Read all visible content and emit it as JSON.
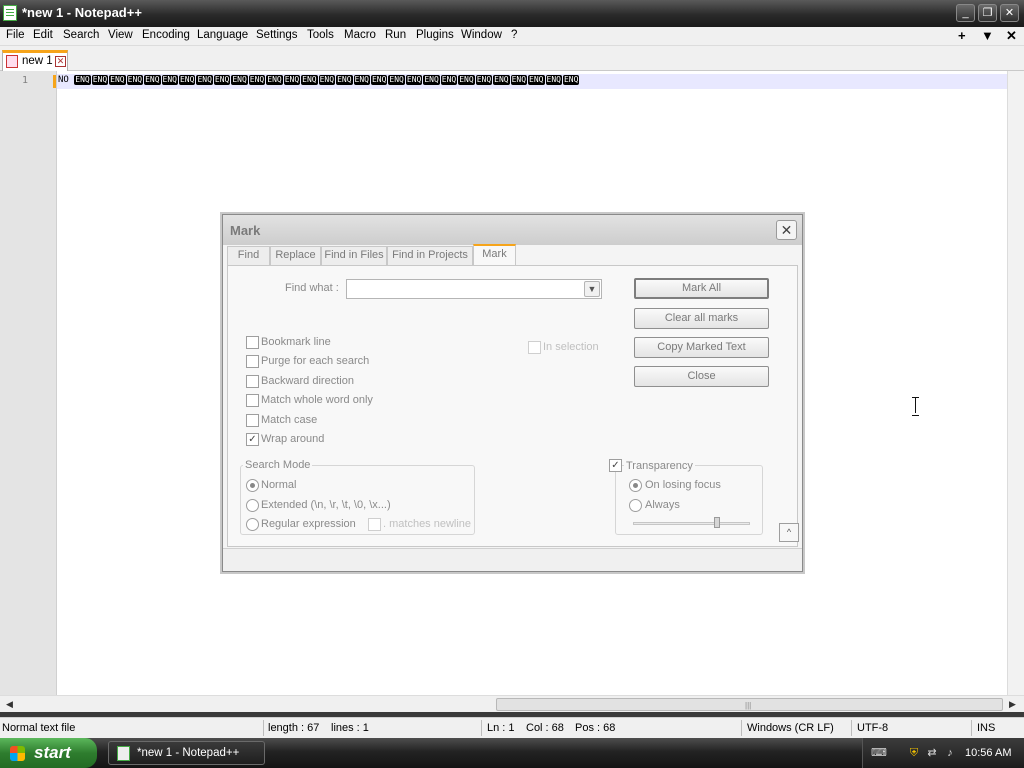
{
  "window": {
    "title": "*new 1 - Notepad++",
    "controls": [
      "minimize",
      "restore",
      "close"
    ]
  },
  "menu": {
    "items": [
      "File",
      "Edit",
      "Search",
      "View",
      "Encoding",
      "Language",
      "Settings",
      "Tools",
      "Macro",
      "Run",
      "Plugins",
      "Window",
      "?"
    ],
    "right": [
      "+",
      "▼",
      "✕"
    ]
  },
  "tabs": [
    {
      "label": "new 1",
      "close": "✕",
      "active": true
    }
  ],
  "editor": {
    "line_number": "1",
    "prefix_text": "NO",
    "char_symbol": "ENQ",
    "char_count": 29
  },
  "dialog": {
    "title": "Mark",
    "close": "✕",
    "tabs": [
      "Find",
      "Replace",
      "Find in Files",
      "Find in Projects",
      "Mark"
    ],
    "active_tab": "Mark",
    "find_what_label": "Find what :",
    "find_what_value": "",
    "checkboxes": [
      {
        "label": "Bookmark line",
        "checked": false
      },
      {
        "label": "Purge for each search",
        "checked": false
      },
      {
        "label": "Backward direction",
        "checked": false
      },
      {
        "label": "Match whole word only",
        "checked": false
      },
      {
        "label": "Match case",
        "checked": false
      },
      {
        "label": "Wrap around",
        "checked": true
      }
    ],
    "in_selection": {
      "label": "In selection",
      "checked": false,
      "enabled": false
    },
    "search_mode": {
      "title": "Search Mode",
      "options": [
        "Normal",
        "Extended (\\n, \\r, \\t, \\0, \\x...)",
        "Regular expression"
      ],
      "selected": "Normal",
      "matches_newline": {
        "label": ". matches newline",
        "checked": false,
        "enabled": false
      }
    },
    "transparency": {
      "label": "Transparency",
      "checked": true,
      "options": [
        "On losing focus",
        "Always"
      ],
      "selected": "On losing focus",
      "level": 0.72
    },
    "buttons": [
      "Mark All",
      "Clear all marks",
      "Copy Marked Text",
      "Close"
    ],
    "collapse": "^"
  },
  "status": {
    "type": "Normal text file",
    "length": "length : 67",
    "lines": "lines : 1",
    "ln": "Ln : 1",
    "col": "Col : 68",
    "pos": "Pos : 68",
    "eol": "Windows (CR LF)",
    "encoding": "UTF-8",
    "mode": "INS"
  },
  "taskbar": {
    "start": "start",
    "task": "*new 1 - Notepad++",
    "clock": "10:56 AM"
  },
  "colors": {
    "accent": "#f6a41a",
    "current_line": "#e8e8ff",
    "gutter": "#e4e4e4"
  }
}
